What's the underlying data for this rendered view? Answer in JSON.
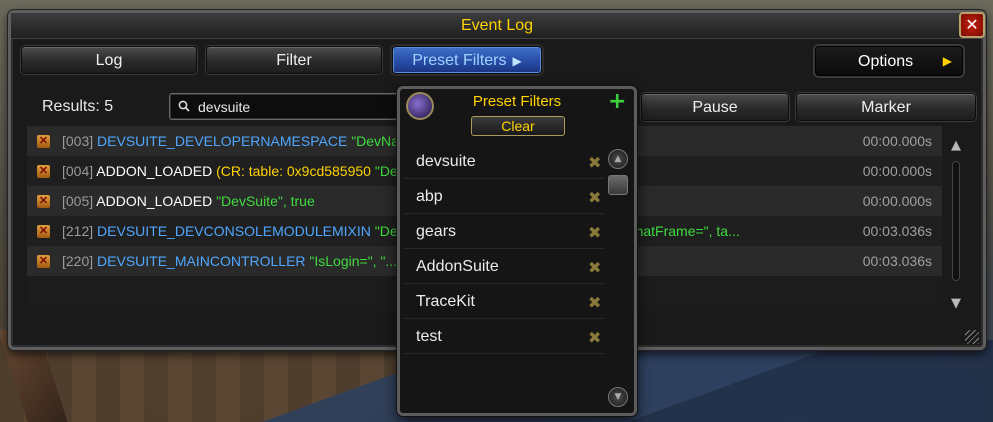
{
  "window": {
    "title": "Event Log",
    "close_label": "✕"
  },
  "toolbar": {
    "log_label": "Log",
    "filter_label": "Filter",
    "preset_label": "Preset Filters",
    "preset_arrow": "▶",
    "options_label": "Options",
    "options_arrow": "▶",
    "pause_label": "Pause",
    "marker_label": "Marker"
  },
  "results": {
    "label": "Results: 5"
  },
  "search": {
    "value": "devsuite",
    "placeholder": ""
  },
  "log": {
    "rows": [
      {
        "id": "[003]",
        "event": "DEVSUITE_DEVELOPERNAMESPACE",
        "args": "\"DevNamespace\", \"Loaded...\"",
        "time": "00:00.000s"
      },
      {
        "id": "[004]",
        "event": "ADDON_LOADED",
        "args_yellow": "(CR: table: 0x9cd585950",
        "args": "\"DevSuite\", true",
        "time": "00:00.000s"
      },
      {
        "id": "[005]",
        "event": "ADDON_LOADED",
        "args": "\"DevSuite\", true",
        "time": "00:00.000s"
      },
      {
        "id": "[212]",
        "event": "DEVSUITE_DEVCONSOLEMODULEMIXIN",
        "args": "\"DebugChatFrame:OnDemand\", \"DebugChatFrame=\", ta...",
        "time": "00:03.036s"
      },
      {
        "id": "[220]",
        "event": "DEVSUITE_MAINCONTROLLER",
        "args": "\"IsLogin=\", \"...ad=\", \"false\", \"IsDev=\", true",
        "time": "00:03.036s"
      }
    ]
  },
  "preset_dropdown": {
    "title": "Preset Filters",
    "add_label": "+",
    "clear_label": "Clear",
    "remove_glyph": "✖",
    "items": [
      "devsuite",
      "abp",
      "gears",
      "AddonSuite",
      "TraceKit",
      "test"
    ]
  },
  "colors": {
    "title_gold": "#ffd200",
    "event_blue": "#4fa7ff",
    "string_green": "#3fdc3f",
    "preset_active": "#2a4faa"
  }
}
